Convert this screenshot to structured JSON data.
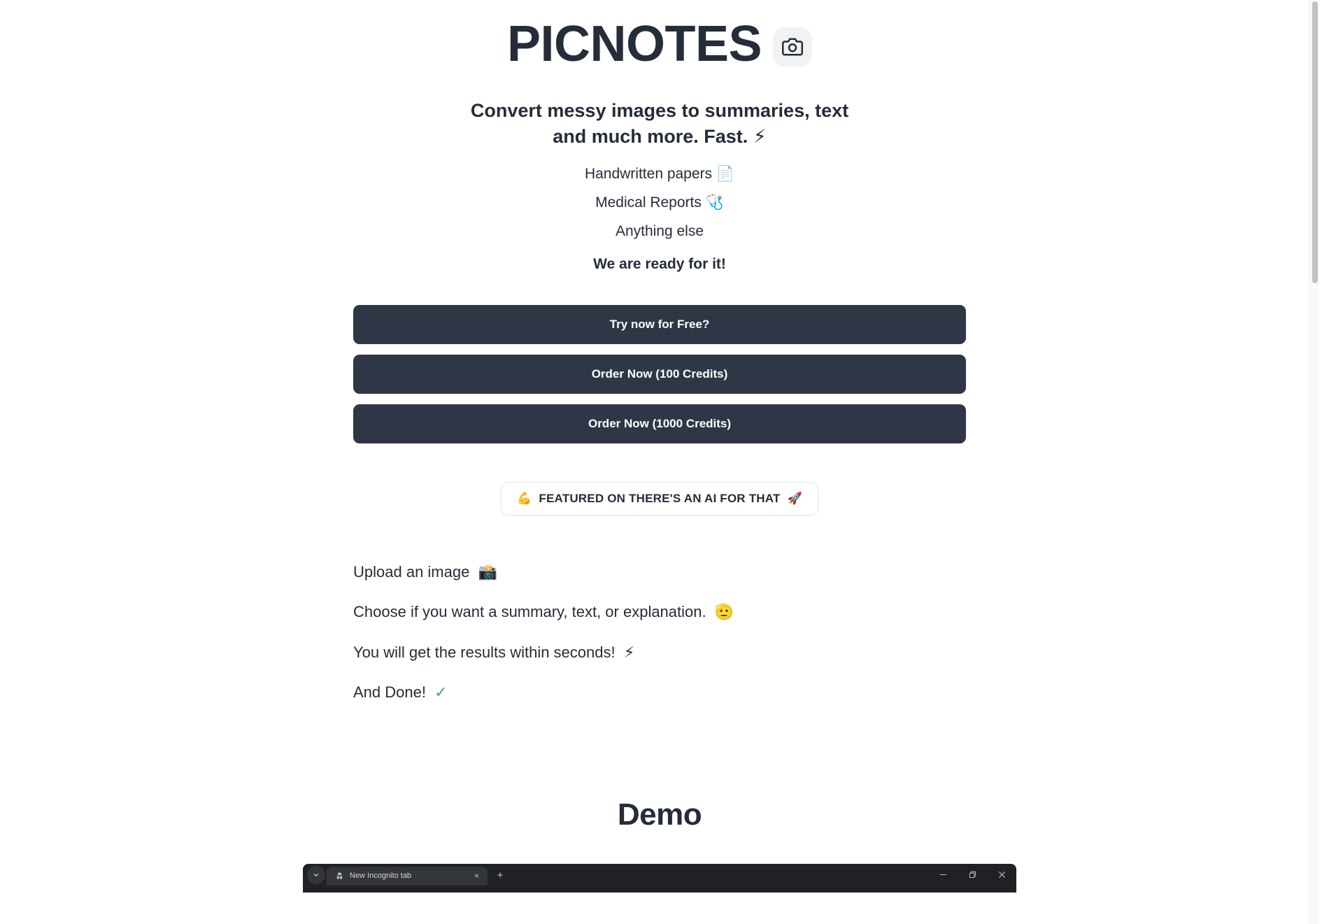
{
  "brand": {
    "title": "PICNOTES",
    "camera_icon": "camera-icon"
  },
  "hero": {
    "subtitle_line1": "Convert messy images to summaries, text",
    "subtitle_line2": "and much more. Fast.",
    "subtitle_emoji": "⚡",
    "features": [
      {
        "label": "Handwritten papers",
        "emoji": "📄",
        "bold": false
      },
      {
        "label": "Medical Reports",
        "emoji": "🩺",
        "bold": false
      },
      {
        "label": "Anything else",
        "emoji": "",
        "bold": false
      },
      {
        "label": "We are ready for it!",
        "emoji": "",
        "bold": true
      }
    ]
  },
  "cta": {
    "try_free": "Try now for Free?",
    "order_100": "Order Now (100 Credits)",
    "order_1000": "Order Now (1000 Credits)"
  },
  "featured": {
    "left_emoji": "💪",
    "text": "FEATURED ON  THERE'S AN AI FOR THAT",
    "right_emoji": "🚀"
  },
  "steps": [
    {
      "text": "Upload an image",
      "emoji": "📸"
    },
    {
      "text": "Choose if you want a summary, text, or explanation.",
      "emoji": "🫡"
    },
    {
      "text": "You will get the results within seconds!",
      "emoji": "⚡"
    },
    {
      "text": "And Done!",
      "emoji": "✓"
    }
  ],
  "demo": {
    "heading": "Demo"
  },
  "browser": {
    "tab_title": "New Incognito tab",
    "tab_search_icon": "chevron-down-icon",
    "favicon": "incognito-icon",
    "close_tab": "×",
    "new_tab": "+",
    "minimize": "minimize-icon",
    "maximize": "restore-icon",
    "close": "close-icon"
  },
  "colors": {
    "ink": "#252c3a",
    "button_bg": "#2f3746",
    "badge_bg": "#f1f2f4",
    "check_green": "#3fa96a",
    "browser_chrome": "#202124",
    "browser_tab": "#323639"
  }
}
